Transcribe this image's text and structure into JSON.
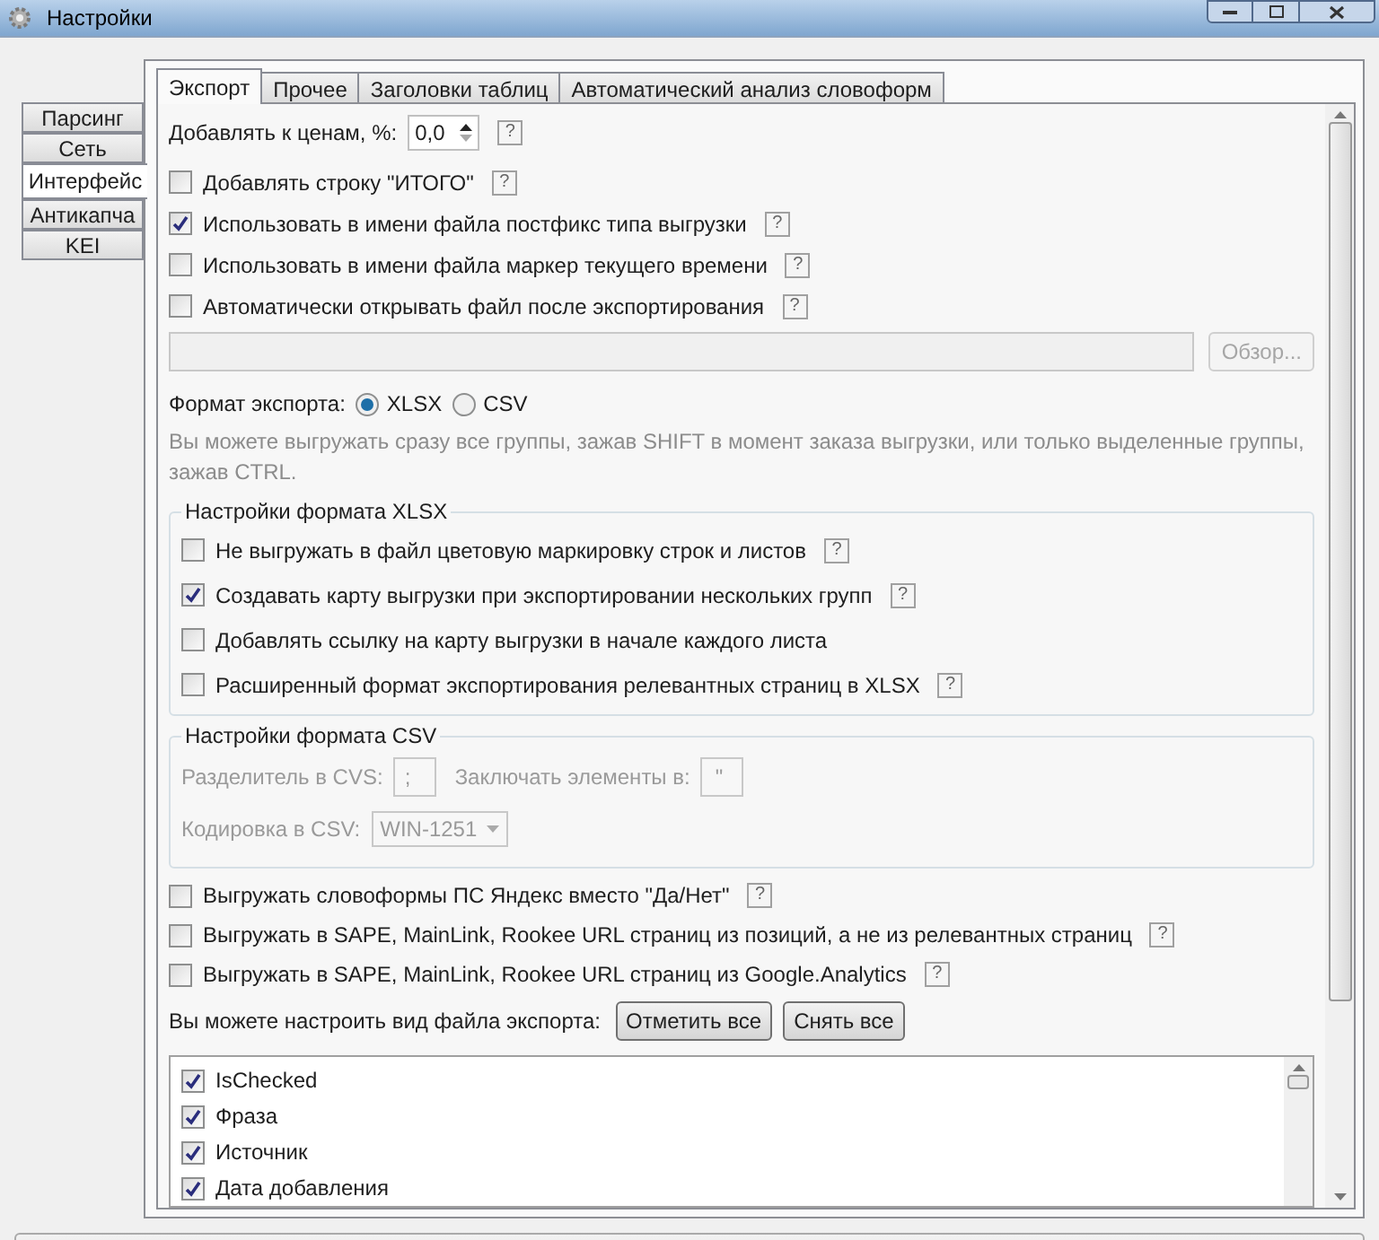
{
  "window": {
    "title": "Настройки"
  },
  "side_tabs": [
    {
      "label": "Парсинг",
      "selected": false
    },
    {
      "label": "Сеть",
      "selected": false
    },
    {
      "label": "Интерфейс",
      "selected": true
    },
    {
      "label": "Антикапча",
      "selected": false
    },
    {
      "label": "KEI",
      "selected": false
    }
  ],
  "tabs": [
    {
      "label": "Экспорт",
      "selected": true
    },
    {
      "label": "Прочее",
      "selected": false
    },
    {
      "label": "Заголовки таблиц",
      "selected": false
    },
    {
      "label": "Автоматический анализ словоформ",
      "selected": false
    }
  ],
  "price": {
    "label": "Добавлять к ценам, %:",
    "value": "0,0",
    "help": "?"
  },
  "options": [
    {
      "label": "Добавлять строку \"ИТОГО\"",
      "checked": false,
      "help": "?"
    },
    {
      "label": "Использовать в имени файла постфикс типа выгрузки",
      "checked": true,
      "help": "?"
    },
    {
      "label": "Использовать в имени файла маркер текущего времени",
      "checked": false,
      "help": "?"
    },
    {
      "label": "Автоматически открывать файл после экспортирования",
      "checked": false,
      "help": "?"
    }
  ],
  "browse_button": {
    "label": "Обзор...",
    "disabled": true
  },
  "format": {
    "label": "Формат экспорта:",
    "options": [
      {
        "label": "XLSX",
        "selected": true
      },
      {
        "label": "CSV",
        "selected": false
      }
    ]
  },
  "hint": "Вы можете выгружать сразу все группы, зажав SHIFT в момент заказа выгрузки, или только выделенные группы, зажав CTRL.",
  "xlsx_group": {
    "title": "Настройки формата XLSX",
    "options": [
      {
        "label": "Не выгружать в файл цветовую маркировку строк и листов",
        "checked": false,
        "help": "?"
      },
      {
        "label": "Создавать карту выгрузки при экспортировании нескольких групп",
        "checked": true,
        "help": "?"
      },
      {
        "label": "Добавлять ссылку на карту выгрузки в начале каждого листа",
        "checked": false
      },
      {
        "label": "Расширенный формат экспортирования релевантных страниц в XLSX",
        "checked": false,
        "help": "?"
      }
    ]
  },
  "csv_group": {
    "title": "Настройки формата CSV",
    "disabled": true,
    "separator": {
      "label": "Разделитель в CVS:",
      "value": ";"
    },
    "enclose": {
      "label": "Заключать элементы в:",
      "value": "\""
    },
    "encoding": {
      "label": "Кодировка в CSV:",
      "value": "WIN-1251"
    }
  },
  "more_options": [
    {
      "label": "Выгружать словоформы ПС Яндекс вместо \"Да/Нет\"",
      "checked": false,
      "help": "?"
    },
    {
      "label": "Выгружать в SAPE, MainLink, Rookee URL страниц из позиций, а не из релевантных страниц",
      "checked": false,
      "help": "?"
    },
    {
      "label": "Выгружать в SAPE, MainLink, Rookee URL страниц из Google.Analytics",
      "checked": false,
      "help": "?"
    }
  ],
  "export_view": {
    "label": "Вы можете настроить вид файла экспорта:",
    "buttons": [
      "Отметить все",
      "Снять все"
    ]
  },
  "columns": [
    {
      "label": "IsChecked",
      "checked": true
    },
    {
      "label": "Фраза",
      "checked": true
    },
    {
      "label": "Источник",
      "checked": true
    },
    {
      "label": "Дата добавления",
      "checked": true
    }
  ]
}
